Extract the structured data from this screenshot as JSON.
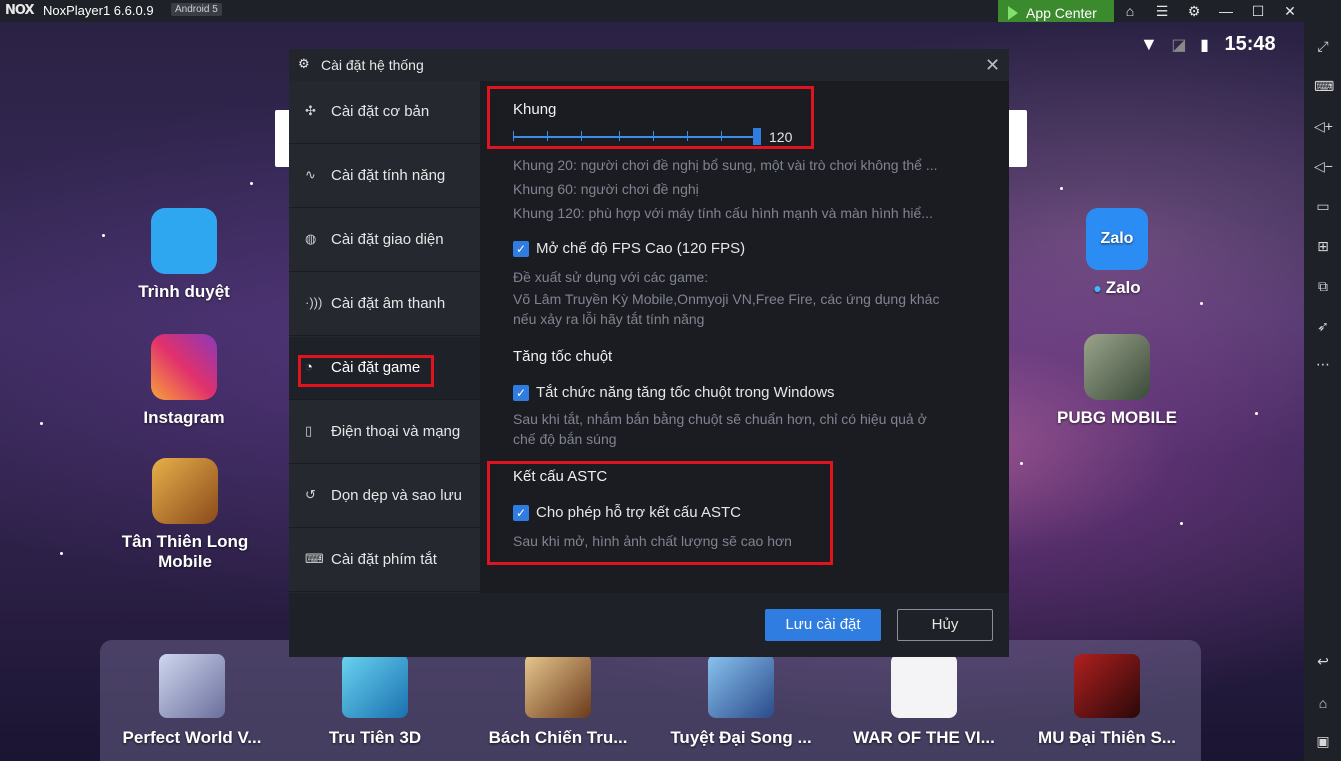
{
  "titlebar": {
    "logo": "NOX",
    "title": "NoxPlayer1 6.6.0.9",
    "android_badge": "Android 5",
    "app_center": "App Center",
    "icons": [
      "home-icon",
      "menu-icon",
      "gear-icon",
      "minimize-icon",
      "maximize-icon",
      "close-icon"
    ]
  },
  "status": {
    "time": "15:48"
  },
  "desktop": {
    "left_apps": [
      {
        "label": "Trình duyệt",
        "color": "#2fa6f0"
      },
      {
        "label": "Instagram",
        "color": "#e1306c"
      },
      {
        "label": "Tân Thiên Long Mobile",
        "color": "#c98a2a"
      }
    ],
    "right_apps": [
      {
        "label": "Zalo",
        "icon_text": "Zalo",
        "color": "#2b8cf3"
      },
      {
        "label": "PUBG MOBILE",
        "color": "#5a6a4a"
      }
    ],
    "dock": [
      {
        "label": "Perfect World V...",
        "color": "#9fa7c8"
      },
      {
        "label": "Tru Tiên 3D",
        "color": "#3fb0dd"
      },
      {
        "label": "Bách Chiến Tru...",
        "color": "#c8a060"
      },
      {
        "label": "Tuyệt Đại Song ...",
        "color": "#4a8ac0"
      },
      {
        "label": "WAR OF THE VI...",
        "color": "#f4f4f6"
      },
      {
        "label": "MU Đại Thiên S...",
        "color": "#5a1010"
      }
    ]
  },
  "dialog": {
    "title": "Cài đặt hệ thống",
    "nav": [
      "Cài đặt cơ bản",
      "Cài đặt tính năng",
      "Cài đặt giao diện",
      "Cài đặt âm thanh",
      "Cài đặt game",
      "Điện thoại và mạng",
      "Dọn dẹp và sao lưu",
      "Cài đặt phím tắt"
    ],
    "selected_nav": "Cài đặt game",
    "frame": {
      "heading": "Khung",
      "value": "120",
      "level": 1.0,
      "hints": [
        "Khung 20: người chơi đề nghị bổ sung, một vài trò chơi không thể ...",
        "Khung 60: người chơi đề nghị",
        "Khung 120: phù hợp với máy tính cấu hình mạnh và màn hình hiể..."
      ]
    },
    "fps": {
      "checked": true,
      "label": "Mở chế độ FPS Cao (120 FPS)",
      "hint1": "Đề xuất sử dụng với các game:",
      "hint2": "Võ Lâm Truyền Kỳ Mobile,Onmyoji VN,Free Fire, các ứng dụng khác",
      "hint3": "nếu xảy ra lỗi hãy tắt tính năng"
    },
    "mouse": {
      "heading": "Tăng tốc chuột",
      "checked": true,
      "label": "Tắt chức năng tăng tốc chuột trong Windows",
      "hint1": "Sau khi tắt, nhắm bắn bằng chuột sẽ chuẩn hơn, chỉ có hiệu quả ở",
      "hint2": "chế độ bắn súng"
    },
    "astc": {
      "heading": "Kết cấu ASTC",
      "checked": true,
      "label": "Cho phép hỗ trợ kết cấu ASTC",
      "hint": "Sau khi mở, hình ảnh chất lượng sẽ cao hơn"
    },
    "save_label": "Lưu cài đặt",
    "cancel_label": "Hủy"
  },
  "colors": {
    "accent": "#2f7de1",
    "highlight": "#e0141c",
    "app_center": "#3b8a2e"
  }
}
